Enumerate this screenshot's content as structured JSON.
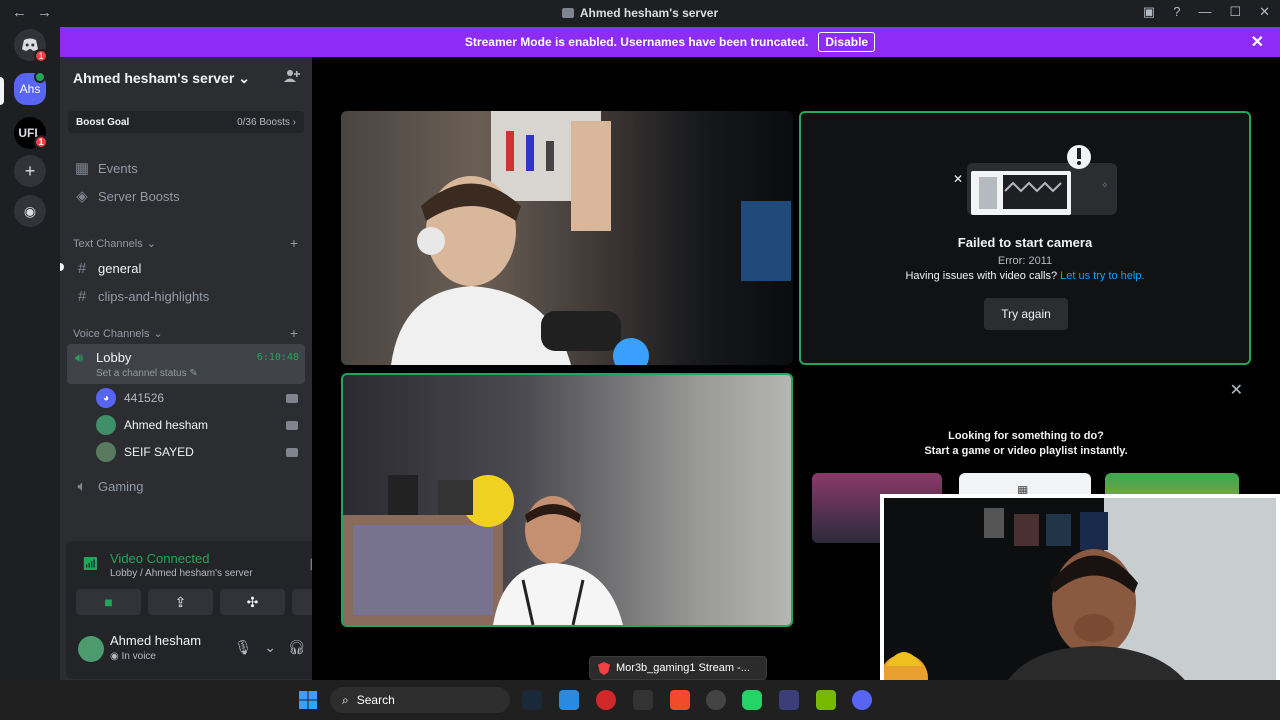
{
  "window": {
    "title": "Ahmed hesham's server",
    "nav_back": "←",
    "nav_forward": "→",
    "controls": [
      "▣",
      "?",
      "—",
      "☐",
      "✕"
    ]
  },
  "rail": {
    "home_badge": "1",
    "server_1": "Ahs",
    "server_2": "UFL",
    "server_2_badge": "1",
    "add_server": "+",
    "discover": "◉"
  },
  "banner": {
    "text": "Streamer Mode is enabled. Usernames have been truncated.",
    "button": "Disable",
    "close": "✕"
  },
  "sidebar": {
    "server_name": "Ahmed hesham's server",
    "boost_label": "Boost Goal",
    "boost_value": "0/36 Boosts",
    "events": "Events",
    "server_boosts": "Server Boosts",
    "text_category": "Text Channels",
    "text_channels": [
      "general",
      "clips-and-highlights"
    ],
    "voice_category": "Voice Channels",
    "lobby_name": "Lobby",
    "lobby_status": "Set a channel status",
    "lobby_time": "6:10:48",
    "voice_users": [
      "441526",
      "Ahmed hesham",
      "SEIF SAYED"
    ],
    "gaming": "Gaming"
  },
  "voice_panel": {
    "title": "Video Connected",
    "subtitle": "Lobby / Ahmed hesham's server",
    "user_name": "Ahmed hesham",
    "user_status": "In voice"
  },
  "error_tile": {
    "title": "Failed to start camera",
    "code": "Error: 2011",
    "help_text": "Having issues with video calls?",
    "help_link": "Let us try to help.",
    "button": "Try again"
  },
  "activity": {
    "line1": "Looking for something to do?",
    "line2": "Start a game or video playlist instantly."
  },
  "taskbar": {
    "search": "Search",
    "tooltip": "Mor3b_gaming1 Stream -..."
  },
  "colors": {
    "accent_green": "#23a55a",
    "streamer_banner": "#8c2cf5",
    "link_blue": "#00a8fc"
  }
}
